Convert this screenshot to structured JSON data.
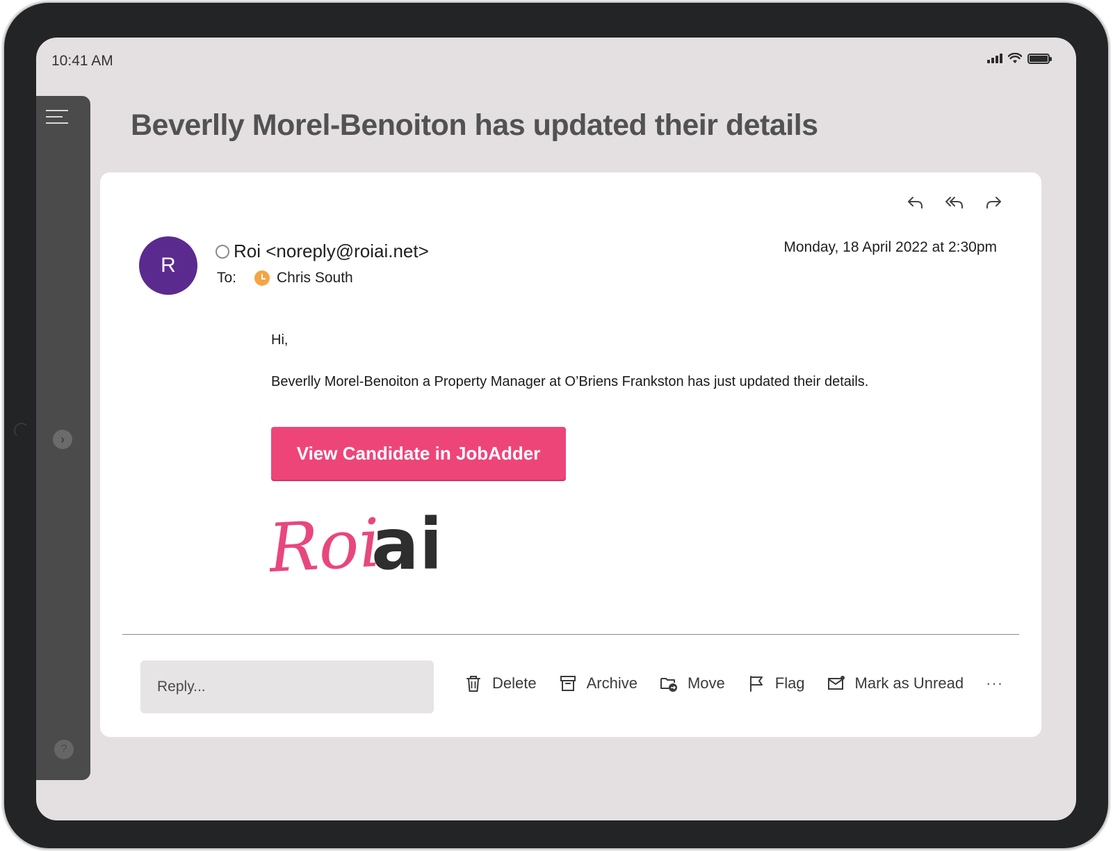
{
  "status_bar": {
    "time": "10:41 AM"
  },
  "email": {
    "subject": "Beverlly Morel-Benoiton has updated their details",
    "avatar_initial": "R",
    "sender": "Roi <noreply@roiai.net>",
    "to_label": "To:",
    "recipient": "Chris South",
    "date": "Monday, 18 April 2022 at 2:30pm",
    "greeting": "Hi,",
    "paragraph": "Beverlly Morel-Benoiton a Property Manager at O’Briens Frankston has just updated their details.",
    "cta_label": "View Candidate in JobAdder",
    "logo_text": "Roiai"
  },
  "reply": {
    "placeholder": "Reply..."
  },
  "toolbar": {
    "delete": "Delete",
    "archive": "Archive",
    "move": "Move",
    "flag": "Flag",
    "mark_unread": "Mark as Unread",
    "more": "···"
  },
  "colors": {
    "accent": "#ee4579",
    "avatar": "#5b2a8f",
    "recipient_badge": "#f4a444",
    "sidebar": "#4b4b4b"
  }
}
